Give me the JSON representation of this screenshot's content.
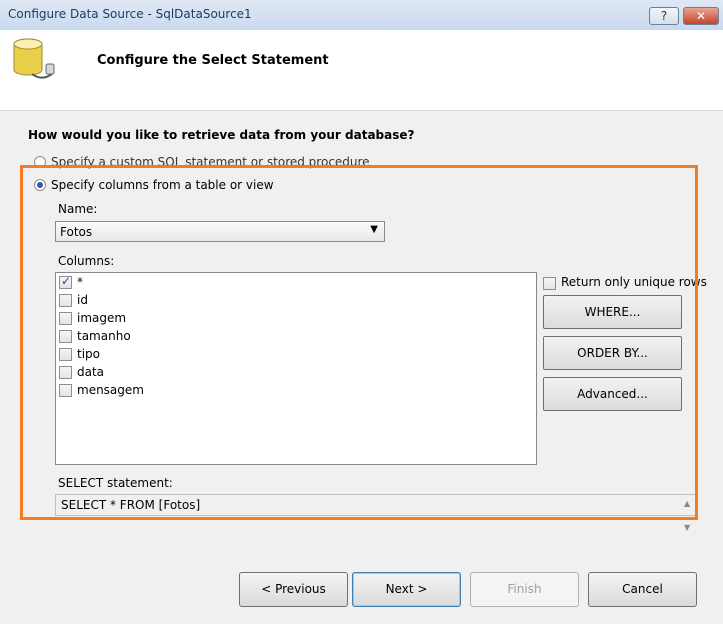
{
  "window": {
    "title": "Configure Data Source - SqlDataSource1",
    "help_label": "?",
    "close_label": "✕"
  },
  "header": {
    "title": "Configure the Select Statement",
    "icon": "database-icon"
  },
  "question": "How would you like to retrieve data from your database?",
  "options": {
    "custom_label": "Specify a custom SQL statement or stored procedure",
    "custom_selected": false,
    "columns_label": "Specify columns from a table or view",
    "columns_selected": true
  },
  "name": {
    "label": "Name:",
    "value": "Fotos"
  },
  "columns": {
    "label": "Columns:",
    "items": [
      {
        "label": "*",
        "checked": true
      },
      {
        "label": "id",
        "checked": false
      },
      {
        "label": "imagem",
        "checked": false
      },
      {
        "label": "tamanho",
        "checked": false
      },
      {
        "label": "tipo",
        "checked": false
      },
      {
        "label": "data",
        "checked": false
      },
      {
        "label": "mensagem",
        "checked": false
      }
    ]
  },
  "unique_rows": {
    "label": "Return only unique rows",
    "checked": false
  },
  "buttons": {
    "where": "WHERE...",
    "order_by": "ORDER BY...",
    "advanced": "Advanced..."
  },
  "select_statement": {
    "label": "SELECT statement:",
    "value": "SELECT * FROM [Fotos]"
  },
  "footer": {
    "previous": "< Previous",
    "next": "Next >",
    "finish": "Finish",
    "cancel": "Cancel"
  },
  "colors": {
    "highlight": "#f47b20",
    "title_bar": "#c9d9ee",
    "close_button": "#c7432a"
  }
}
